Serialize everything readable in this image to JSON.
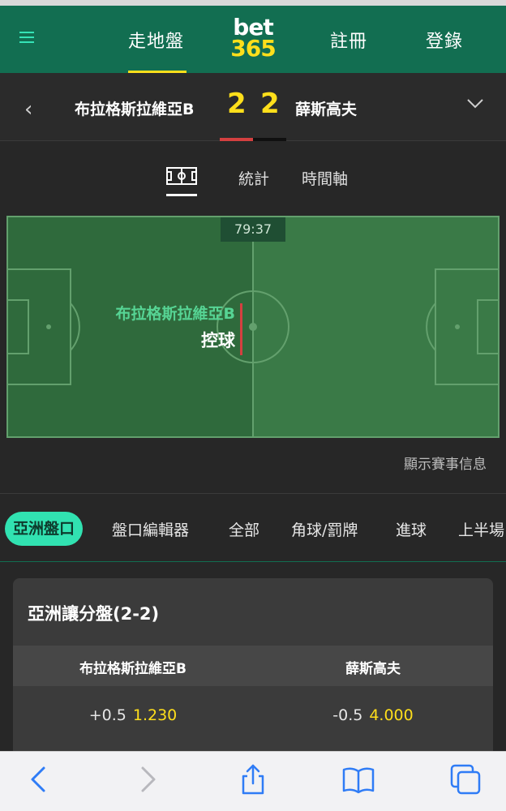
{
  "header": {
    "menu_icon": "hamburger-icon",
    "nav_live": "走地盤",
    "logo_line1": "bet",
    "logo_line2": "365",
    "nav_register": "註冊",
    "nav_login": "登錄",
    "brand_color": "#126e51",
    "accent_color": "#ffdf1b"
  },
  "scoreboard": {
    "home_team": "布拉格斯拉維亞B",
    "away_team": "薛斯高夫",
    "home_score": "2",
    "away_score": "2"
  },
  "view_tabs": {
    "pitch_icon": "pitch-icon",
    "stats": "統計",
    "timeline": "時間軸"
  },
  "pitch": {
    "clock": "79:37",
    "possession_team": "布拉格斯拉維亞B",
    "possession_label": "控球",
    "show_info": "顯示賽事信息"
  },
  "market_tabs": [
    "亞洲盤口",
    "盤口編輯器",
    "全部",
    "角球/罰牌",
    "進球",
    "上半場"
  ],
  "market_card": {
    "title": "亞洲讓分盤(2-2)",
    "home_header": "布拉格斯拉維亞B",
    "away_header": "薛斯高夫",
    "home_handicap": "+0.5",
    "home_price": "1.230",
    "away_handicap": "-0.5",
    "away_price": "4.000"
  },
  "browser_toolbar": {
    "icons": [
      "back-icon",
      "forward-icon",
      "share-icon",
      "bookmarks-icon",
      "tabs-icon"
    ]
  }
}
